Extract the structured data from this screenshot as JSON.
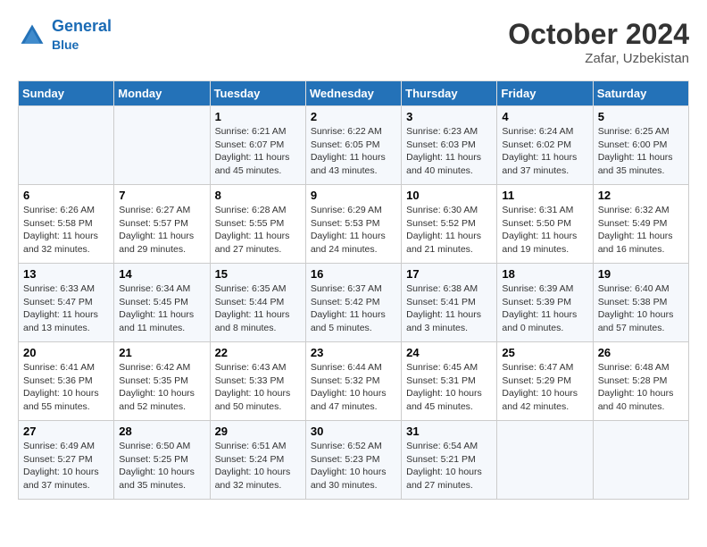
{
  "header": {
    "logo_line1": "General",
    "logo_line2": "Blue",
    "month": "October 2024",
    "location": "Zafar, Uzbekistan"
  },
  "days_of_week": [
    "Sunday",
    "Monday",
    "Tuesday",
    "Wednesday",
    "Thursday",
    "Friday",
    "Saturday"
  ],
  "weeks": [
    [
      {
        "day": "",
        "info": ""
      },
      {
        "day": "",
        "info": ""
      },
      {
        "day": "1",
        "info": "Sunrise: 6:21 AM\nSunset: 6:07 PM\nDaylight: 11 hours and 45 minutes."
      },
      {
        "day": "2",
        "info": "Sunrise: 6:22 AM\nSunset: 6:05 PM\nDaylight: 11 hours and 43 minutes."
      },
      {
        "day": "3",
        "info": "Sunrise: 6:23 AM\nSunset: 6:03 PM\nDaylight: 11 hours and 40 minutes."
      },
      {
        "day": "4",
        "info": "Sunrise: 6:24 AM\nSunset: 6:02 PM\nDaylight: 11 hours and 37 minutes."
      },
      {
        "day": "5",
        "info": "Sunrise: 6:25 AM\nSunset: 6:00 PM\nDaylight: 11 hours and 35 minutes."
      }
    ],
    [
      {
        "day": "6",
        "info": "Sunrise: 6:26 AM\nSunset: 5:58 PM\nDaylight: 11 hours and 32 minutes."
      },
      {
        "day": "7",
        "info": "Sunrise: 6:27 AM\nSunset: 5:57 PM\nDaylight: 11 hours and 29 minutes."
      },
      {
        "day": "8",
        "info": "Sunrise: 6:28 AM\nSunset: 5:55 PM\nDaylight: 11 hours and 27 minutes."
      },
      {
        "day": "9",
        "info": "Sunrise: 6:29 AM\nSunset: 5:53 PM\nDaylight: 11 hours and 24 minutes."
      },
      {
        "day": "10",
        "info": "Sunrise: 6:30 AM\nSunset: 5:52 PM\nDaylight: 11 hours and 21 minutes."
      },
      {
        "day": "11",
        "info": "Sunrise: 6:31 AM\nSunset: 5:50 PM\nDaylight: 11 hours and 19 minutes."
      },
      {
        "day": "12",
        "info": "Sunrise: 6:32 AM\nSunset: 5:49 PM\nDaylight: 11 hours and 16 minutes."
      }
    ],
    [
      {
        "day": "13",
        "info": "Sunrise: 6:33 AM\nSunset: 5:47 PM\nDaylight: 11 hours and 13 minutes."
      },
      {
        "day": "14",
        "info": "Sunrise: 6:34 AM\nSunset: 5:45 PM\nDaylight: 11 hours and 11 minutes."
      },
      {
        "day": "15",
        "info": "Sunrise: 6:35 AM\nSunset: 5:44 PM\nDaylight: 11 hours and 8 minutes."
      },
      {
        "day": "16",
        "info": "Sunrise: 6:37 AM\nSunset: 5:42 PM\nDaylight: 11 hours and 5 minutes."
      },
      {
        "day": "17",
        "info": "Sunrise: 6:38 AM\nSunset: 5:41 PM\nDaylight: 11 hours and 3 minutes."
      },
      {
        "day": "18",
        "info": "Sunrise: 6:39 AM\nSunset: 5:39 PM\nDaylight: 11 hours and 0 minutes."
      },
      {
        "day": "19",
        "info": "Sunrise: 6:40 AM\nSunset: 5:38 PM\nDaylight: 10 hours and 57 minutes."
      }
    ],
    [
      {
        "day": "20",
        "info": "Sunrise: 6:41 AM\nSunset: 5:36 PM\nDaylight: 10 hours and 55 minutes."
      },
      {
        "day": "21",
        "info": "Sunrise: 6:42 AM\nSunset: 5:35 PM\nDaylight: 10 hours and 52 minutes."
      },
      {
        "day": "22",
        "info": "Sunrise: 6:43 AM\nSunset: 5:33 PM\nDaylight: 10 hours and 50 minutes."
      },
      {
        "day": "23",
        "info": "Sunrise: 6:44 AM\nSunset: 5:32 PM\nDaylight: 10 hours and 47 minutes."
      },
      {
        "day": "24",
        "info": "Sunrise: 6:45 AM\nSunset: 5:31 PM\nDaylight: 10 hours and 45 minutes."
      },
      {
        "day": "25",
        "info": "Sunrise: 6:47 AM\nSunset: 5:29 PM\nDaylight: 10 hours and 42 minutes."
      },
      {
        "day": "26",
        "info": "Sunrise: 6:48 AM\nSunset: 5:28 PM\nDaylight: 10 hours and 40 minutes."
      }
    ],
    [
      {
        "day": "27",
        "info": "Sunrise: 6:49 AM\nSunset: 5:27 PM\nDaylight: 10 hours and 37 minutes."
      },
      {
        "day": "28",
        "info": "Sunrise: 6:50 AM\nSunset: 5:25 PM\nDaylight: 10 hours and 35 minutes."
      },
      {
        "day": "29",
        "info": "Sunrise: 6:51 AM\nSunset: 5:24 PM\nDaylight: 10 hours and 32 minutes."
      },
      {
        "day": "30",
        "info": "Sunrise: 6:52 AM\nSunset: 5:23 PM\nDaylight: 10 hours and 30 minutes."
      },
      {
        "day": "31",
        "info": "Sunrise: 6:54 AM\nSunset: 5:21 PM\nDaylight: 10 hours and 27 minutes."
      },
      {
        "day": "",
        "info": ""
      },
      {
        "day": "",
        "info": ""
      }
    ]
  ]
}
